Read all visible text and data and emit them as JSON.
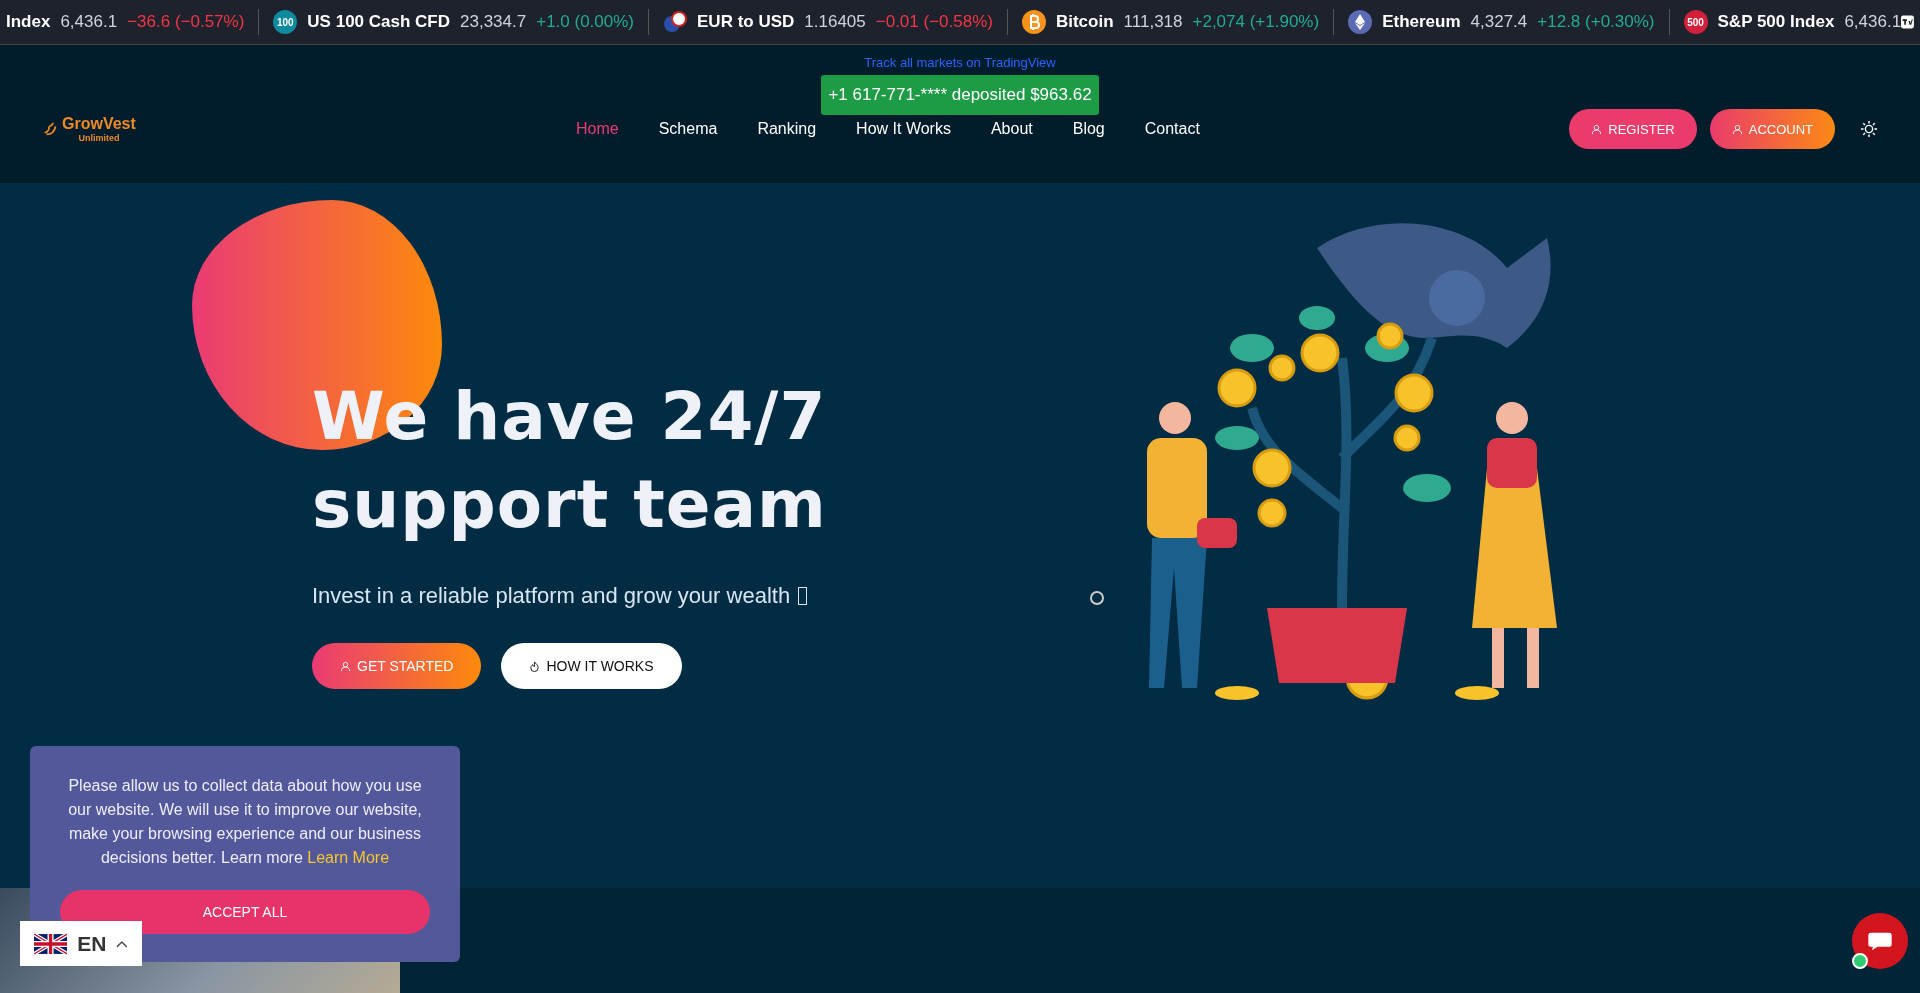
{
  "ticker": {
    "items": [
      {
        "kind": "none",
        "name": "Index",
        "price": "6,436.1",
        "change": "−36.6 (−0.57%)",
        "negative": true
      },
      {
        "kind": "badge",
        "badge": "100",
        "color": "#0e8a9e",
        "name": "US 100 Cash CFD",
        "price": "23,334.7",
        "change": "+1.0 (0.00%)",
        "negative": false
      },
      {
        "kind": "flag",
        "name": "EUR to USD",
        "price": "1.16405",
        "change": "−0.01 (−0.58%)",
        "negative": true
      },
      {
        "kind": "bitcoin",
        "name": "Bitcoin",
        "price": "111,318",
        "change": "+2,074 (+1.90%)",
        "negative": false
      },
      {
        "kind": "ethereum",
        "name": "Ethereum",
        "price": "4,327.4",
        "change": "+12.8 (+0.30%)",
        "negative": false
      },
      {
        "kind": "badge",
        "badge": "500",
        "color": "#d0213a",
        "name": "S&P 500 Index",
        "price": "6,436.1"
      }
    ],
    "link": "Track all markets on TradingView"
  },
  "header": {
    "logo": {
      "name": "GrowVest",
      "tagline": "Unlimited"
    },
    "nav": [
      {
        "label": "Home",
        "selected": true
      },
      {
        "label": "Schema",
        "selected": false
      },
      {
        "label": "Ranking",
        "selected": false
      },
      {
        "label": "How It Works",
        "selected": false
      },
      {
        "label": "About",
        "selected": false
      },
      {
        "label": "Blog",
        "selected": false
      },
      {
        "label": "Contact",
        "selected": false
      }
    ],
    "buttons": [
      "REGISTER",
      "ACCOUNT"
    ]
  },
  "toast": "+1 617-771-**** deposited $963.62",
  "hero": {
    "title_lines": [
      "We have 24/7",
      "support team"
    ],
    "subtitle": "Invest in a reliable platform and grow your wealth",
    "buttons": [
      {
        "label": "GET STARTED",
        "kind": "primary"
      },
      {
        "label": "HOW IT WORKS",
        "kind": "secondary"
      }
    ]
  },
  "cookie": {
    "text": "Please allow us to collect data about how you use our website. We will use it to improve our website, make your browsing experience and our business decisions better. Learn more",
    "link": "Learn More",
    "button": "ACCEPT ALL"
  },
  "language": "EN"
}
